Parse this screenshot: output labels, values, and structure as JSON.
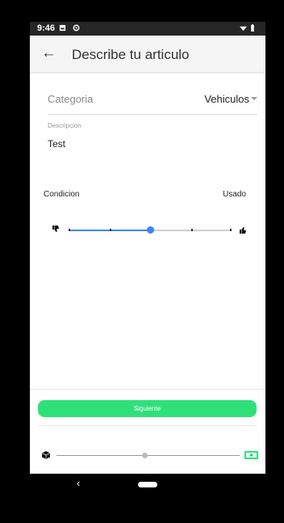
{
  "status_bar": {
    "time": "9:46"
  },
  "app_bar": {
    "title": "Describe tu articulo"
  },
  "form": {
    "category_label": "Categoria",
    "category_value": "Vehiculos",
    "description_label": "Descripcion",
    "description_value": "Test",
    "condition_label": "Condicion",
    "condition_value": "Usado",
    "condition_slider_level": 0.5
  },
  "footer": {
    "next_button": "Siguiente",
    "progress_level": 0.48
  },
  "colors": {
    "accent": "#3d86f0",
    "button": "#2fe07a"
  }
}
